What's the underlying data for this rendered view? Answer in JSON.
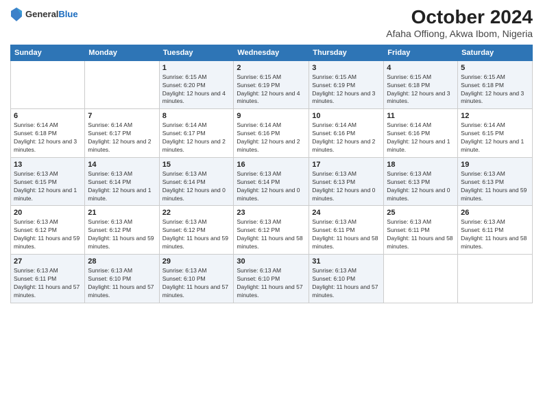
{
  "header": {
    "logo_line1": "General",
    "logo_line2": "Blue",
    "title": "October 2024",
    "subtitle": "Afaha Offiong, Akwa Ibom, Nigeria"
  },
  "weekdays": [
    "Sunday",
    "Monday",
    "Tuesday",
    "Wednesday",
    "Thursday",
    "Friday",
    "Saturday"
  ],
  "weeks": [
    [
      {
        "day": "",
        "sunrise": "",
        "sunset": "",
        "daylight": ""
      },
      {
        "day": "",
        "sunrise": "",
        "sunset": "",
        "daylight": ""
      },
      {
        "day": "1",
        "sunrise": "Sunrise: 6:15 AM",
        "sunset": "Sunset: 6:20 PM",
        "daylight": "Daylight: 12 hours and 4 minutes."
      },
      {
        "day": "2",
        "sunrise": "Sunrise: 6:15 AM",
        "sunset": "Sunset: 6:19 PM",
        "daylight": "Daylight: 12 hours and 4 minutes."
      },
      {
        "day": "3",
        "sunrise": "Sunrise: 6:15 AM",
        "sunset": "Sunset: 6:19 PM",
        "daylight": "Daylight: 12 hours and 3 minutes."
      },
      {
        "day": "4",
        "sunrise": "Sunrise: 6:15 AM",
        "sunset": "Sunset: 6:18 PM",
        "daylight": "Daylight: 12 hours and 3 minutes."
      },
      {
        "day": "5",
        "sunrise": "Sunrise: 6:15 AM",
        "sunset": "Sunset: 6:18 PM",
        "daylight": "Daylight: 12 hours and 3 minutes."
      }
    ],
    [
      {
        "day": "6",
        "sunrise": "Sunrise: 6:14 AM",
        "sunset": "Sunset: 6:18 PM",
        "daylight": "Daylight: 12 hours and 3 minutes."
      },
      {
        "day": "7",
        "sunrise": "Sunrise: 6:14 AM",
        "sunset": "Sunset: 6:17 PM",
        "daylight": "Daylight: 12 hours and 2 minutes."
      },
      {
        "day": "8",
        "sunrise": "Sunrise: 6:14 AM",
        "sunset": "Sunset: 6:17 PM",
        "daylight": "Daylight: 12 hours and 2 minutes."
      },
      {
        "day": "9",
        "sunrise": "Sunrise: 6:14 AM",
        "sunset": "Sunset: 6:16 PM",
        "daylight": "Daylight: 12 hours and 2 minutes."
      },
      {
        "day": "10",
        "sunrise": "Sunrise: 6:14 AM",
        "sunset": "Sunset: 6:16 PM",
        "daylight": "Daylight: 12 hours and 2 minutes."
      },
      {
        "day": "11",
        "sunrise": "Sunrise: 6:14 AM",
        "sunset": "Sunset: 6:16 PM",
        "daylight": "Daylight: 12 hours and 1 minute."
      },
      {
        "day": "12",
        "sunrise": "Sunrise: 6:14 AM",
        "sunset": "Sunset: 6:15 PM",
        "daylight": "Daylight: 12 hours and 1 minute."
      }
    ],
    [
      {
        "day": "13",
        "sunrise": "Sunrise: 6:13 AM",
        "sunset": "Sunset: 6:15 PM",
        "daylight": "Daylight: 12 hours and 1 minute."
      },
      {
        "day": "14",
        "sunrise": "Sunrise: 6:13 AM",
        "sunset": "Sunset: 6:14 PM",
        "daylight": "Daylight: 12 hours and 1 minute."
      },
      {
        "day": "15",
        "sunrise": "Sunrise: 6:13 AM",
        "sunset": "Sunset: 6:14 PM",
        "daylight": "Daylight: 12 hours and 0 minutes."
      },
      {
        "day": "16",
        "sunrise": "Sunrise: 6:13 AM",
        "sunset": "Sunset: 6:14 PM",
        "daylight": "Daylight: 12 hours and 0 minutes."
      },
      {
        "day": "17",
        "sunrise": "Sunrise: 6:13 AM",
        "sunset": "Sunset: 6:13 PM",
        "daylight": "Daylight: 12 hours and 0 minutes."
      },
      {
        "day": "18",
        "sunrise": "Sunrise: 6:13 AM",
        "sunset": "Sunset: 6:13 PM",
        "daylight": "Daylight: 12 hours and 0 minutes."
      },
      {
        "day": "19",
        "sunrise": "Sunrise: 6:13 AM",
        "sunset": "Sunset: 6:13 PM",
        "daylight": "Daylight: 11 hours and 59 minutes."
      }
    ],
    [
      {
        "day": "20",
        "sunrise": "Sunrise: 6:13 AM",
        "sunset": "Sunset: 6:12 PM",
        "daylight": "Daylight: 11 hours and 59 minutes."
      },
      {
        "day": "21",
        "sunrise": "Sunrise: 6:13 AM",
        "sunset": "Sunset: 6:12 PM",
        "daylight": "Daylight: 11 hours and 59 minutes."
      },
      {
        "day": "22",
        "sunrise": "Sunrise: 6:13 AM",
        "sunset": "Sunset: 6:12 PM",
        "daylight": "Daylight: 11 hours and 59 minutes."
      },
      {
        "day": "23",
        "sunrise": "Sunrise: 6:13 AM",
        "sunset": "Sunset: 6:12 PM",
        "daylight": "Daylight: 11 hours and 58 minutes."
      },
      {
        "day": "24",
        "sunrise": "Sunrise: 6:13 AM",
        "sunset": "Sunset: 6:11 PM",
        "daylight": "Daylight: 11 hours and 58 minutes."
      },
      {
        "day": "25",
        "sunrise": "Sunrise: 6:13 AM",
        "sunset": "Sunset: 6:11 PM",
        "daylight": "Daylight: 11 hours and 58 minutes."
      },
      {
        "day": "26",
        "sunrise": "Sunrise: 6:13 AM",
        "sunset": "Sunset: 6:11 PM",
        "daylight": "Daylight: 11 hours and 58 minutes."
      }
    ],
    [
      {
        "day": "27",
        "sunrise": "Sunrise: 6:13 AM",
        "sunset": "Sunset: 6:11 PM",
        "daylight": "Daylight: 11 hours and 57 minutes."
      },
      {
        "day": "28",
        "sunrise": "Sunrise: 6:13 AM",
        "sunset": "Sunset: 6:10 PM",
        "daylight": "Daylight: 11 hours and 57 minutes."
      },
      {
        "day": "29",
        "sunrise": "Sunrise: 6:13 AM",
        "sunset": "Sunset: 6:10 PM",
        "daylight": "Daylight: 11 hours and 57 minutes."
      },
      {
        "day": "30",
        "sunrise": "Sunrise: 6:13 AM",
        "sunset": "Sunset: 6:10 PM",
        "daylight": "Daylight: 11 hours and 57 minutes."
      },
      {
        "day": "31",
        "sunrise": "Sunrise: 6:13 AM",
        "sunset": "Sunset: 6:10 PM",
        "daylight": "Daylight: 11 hours and 57 minutes."
      },
      {
        "day": "",
        "sunrise": "",
        "sunset": "",
        "daylight": ""
      },
      {
        "day": "",
        "sunrise": "",
        "sunset": "",
        "daylight": ""
      }
    ]
  ]
}
